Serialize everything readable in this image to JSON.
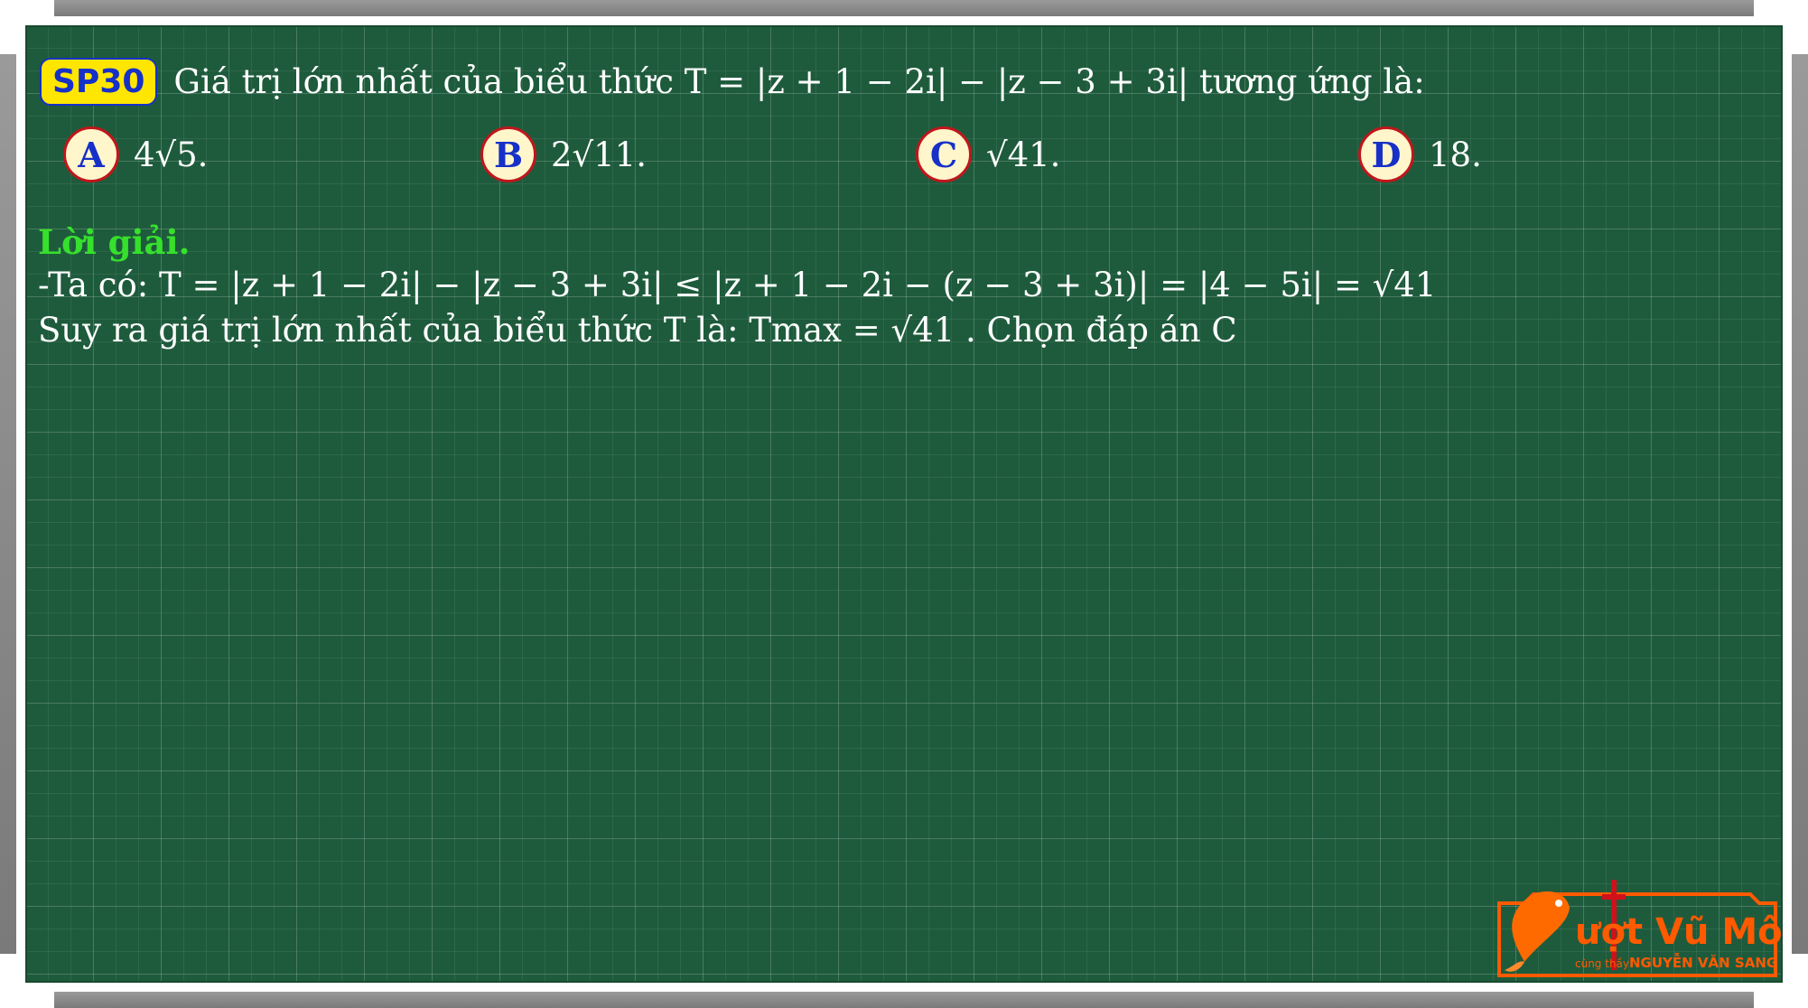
{
  "question": {
    "badge": "SP30",
    "text": "Giá trị lớn nhất của biểu thức T = |z + 1 − 2i| − |z − 3 + 3i| tương ứng là:"
  },
  "options": [
    {
      "letter": "A",
      "value": "4√5."
    },
    {
      "letter": "B",
      "value": "2√11."
    },
    {
      "letter": "C",
      "value": "√41."
    },
    {
      "letter": "D",
      "value": "18."
    }
  ],
  "solution": {
    "heading": "Lời giải.",
    "line1": "-Ta có: T = |z + 1 − 2i| − |z − 3 + 3i| ≤ |z + 1 − 2i − (z − 3 + 3i)| = |4 − 5i| = √41",
    "line2": "Suy ra giá trị lớn nhất của biểu thức T là: Tmax = √41 . Chọn đáp án C"
  },
  "logo": {
    "title": "ượt Vũ Môn",
    "subtitle_small": "cùng thầy",
    "subtitle_name": "NGUYỄN VĂN SANG"
  },
  "colors": {
    "board": "#1e5b3c",
    "badge_bg": "#ffe600",
    "badge_text": "#1630c8",
    "heading": "#36e02c",
    "option_circle_border": "#c0161c",
    "logo": "#ff5a00"
  }
}
